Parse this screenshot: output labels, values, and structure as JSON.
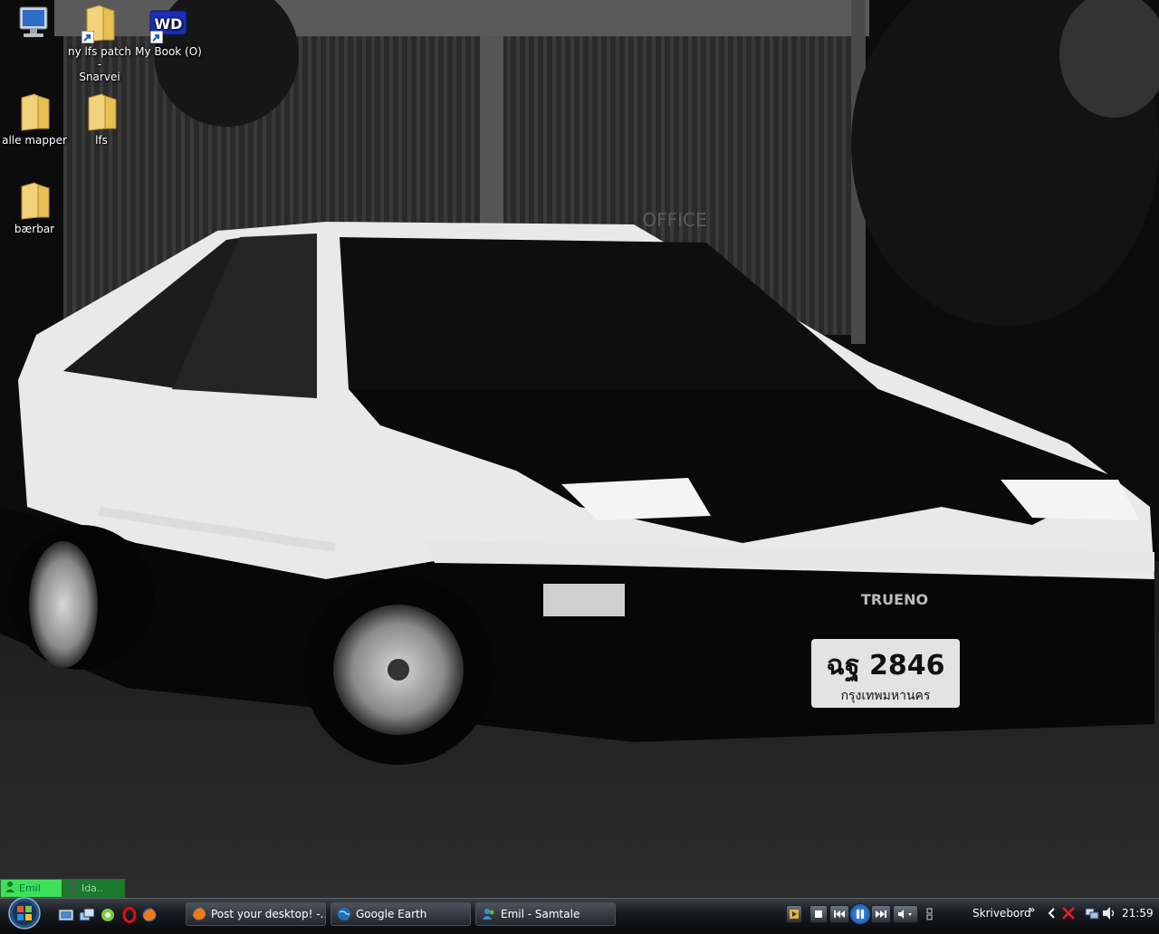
{
  "desktop_icons": [
    {
      "name": "computer",
      "label": ""
    },
    {
      "name": "ny-lfs-patch",
      "label": "ny lfs patch -\nSnarvei"
    },
    {
      "name": "my-book",
      "label": "My Book (O)"
    },
    {
      "name": "alle-mapper",
      "label": "alle mapper"
    },
    {
      "name": "lfs",
      "label": "lfs"
    },
    {
      "name": "baerbar",
      "label": "bærbar"
    }
  ],
  "wallpaper": {
    "office_sign": "OFFICE",
    "car_badge": "TRUENO",
    "plate_top": "ฉฐ 2846",
    "plate_bottom": "กรุงเทพมหานคร"
  },
  "chat_tabs": [
    {
      "label": "Emil",
      "state": "active"
    },
    {
      "label": "Ida..",
      "state": "idle"
    }
  ],
  "taskbar": {
    "buttons": [
      {
        "label": "Post your desktop! -...",
        "icon": "firefox-icon"
      },
      {
        "label": "Google Earth",
        "icon": "google-earth-icon"
      },
      {
        "label": "Emil - Samtale",
        "icon": "messenger-icon"
      }
    ],
    "desktop_toolbar": "Skrivebord",
    "chevron": "»",
    "clock": "21:59"
  },
  "colors": {
    "taskbar": "#191c21",
    "chat_active": "#3ee05a",
    "chat_idle": "#1b7a2d"
  }
}
